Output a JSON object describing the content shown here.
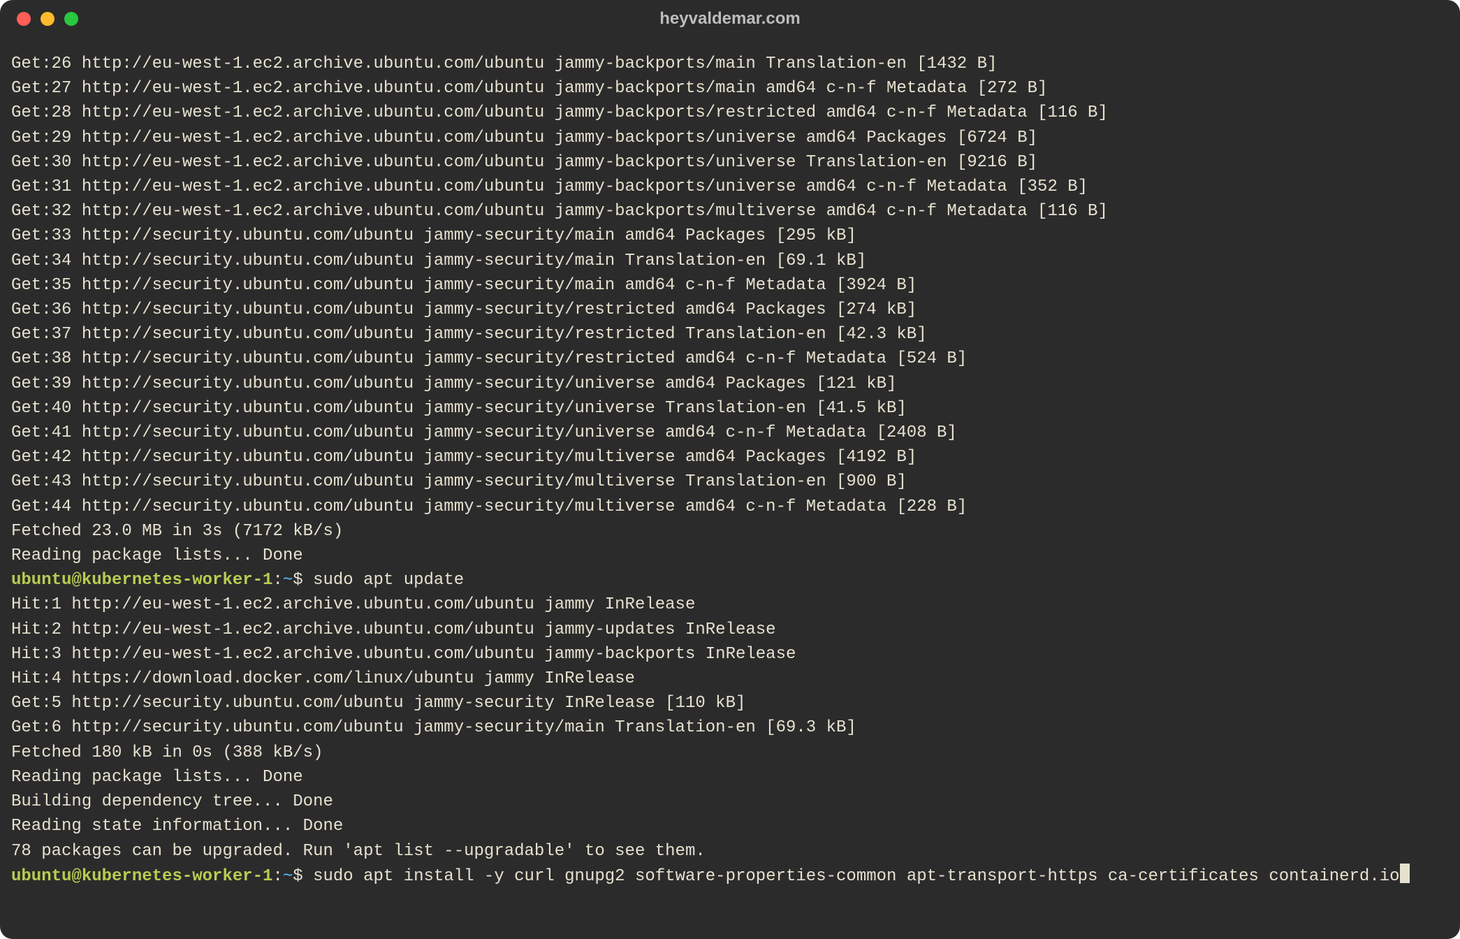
{
  "window": {
    "title": "heyvaldemar.com"
  },
  "prompt": {
    "user_host": "ubuntu@kubernetes-worker-1",
    "colon": ":",
    "path": "~",
    "dollar": "$"
  },
  "output": {
    "l0": "Get:26 http://eu-west-1.ec2.archive.ubuntu.com/ubuntu jammy-backports/main Translation-en [1432 B]",
    "l1": "Get:27 http://eu-west-1.ec2.archive.ubuntu.com/ubuntu jammy-backports/main amd64 c-n-f Metadata [272 B]",
    "l2": "Get:28 http://eu-west-1.ec2.archive.ubuntu.com/ubuntu jammy-backports/restricted amd64 c-n-f Metadata [116 B]",
    "l3": "Get:29 http://eu-west-1.ec2.archive.ubuntu.com/ubuntu jammy-backports/universe amd64 Packages [6724 B]",
    "l4": "Get:30 http://eu-west-1.ec2.archive.ubuntu.com/ubuntu jammy-backports/universe Translation-en [9216 B]",
    "l5": "Get:31 http://eu-west-1.ec2.archive.ubuntu.com/ubuntu jammy-backports/universe amd64 c-n-f Metadata [352 B]",
    "l6": "Get:32 http://eu-west-1.ec2.archive.ubuntu.com/ubuntu jammy-backports/multiverse amd64 c-n-f Metadata [116 B]",
    "l7": "Get:33 http://security.ubuntu.com/ubuntu jammy-security/main amd64 Packages [295 kB]",
    "l8": "Get:34 http://security.ubuntu.com/ubuntu jammy-security/main Translation-en [69.1 kB]",
    "l9": "Get:35 http://security.ubuntu.com/ubuntu jammy-security/main amd64 c-n-f Metadata [3924 B]",
    "l10": "Get:36 http://security.ubuntu.com/ubuntu jammy-security/restricted amd64 Packages [274 kB]",
    "l11": "Get:37 http://security.ubuntu.com/ubuntu jammy-security/restricted Translation-en [42.3 kB]",
    "l12": "Get:38 http://security.ubuntu.com/ubuntu jammy-security/restricted amd64 c-n-f Metadata [524 B]",
    "l13": "Get:39 http://security.ubuntu.com/ubuntu jammy-security/universe amd64 Packages [121 kB]",
    "l14": "Get:40 http://security.ubuntu.com/ubuntu jammy-security/universe Translation-en [41.5 kB]",
    "l15": "Get:41 http://security.ubuntu.com/ubuntu jammy-security/universe amd64 c-n-f Metadata [2408 B]",
    "l16": "Get:42 http://security.ubuntu.com/ubuntu jammy-security/multiverse amd64 Packages [4192 B]",
    "l17": "Get:43 http://security.ubuntu.com/ubuntu jammy-security/multiverse Translation-en [900 B]",
    "l18": "Get:44 http://security.ubuntu.com/ubuntu jammy-security/multiverse amd64 c-n-f Metadata [228 B]",
    "l19": "Fetched 23.0 MB in 3s (7172 kB/s)",
    "l20": "Reading package lists... Done",
    "l21": "Hit:1 http://eu-west-1.ec2.archive.ubuntu.com/ubuntu jammy InRelease",
    "l22": "Hit:2 http://eu-west-1.ec2.archive.ubuntu.com/ubuntu jammy-updates InRelease",
    "l23": "Hit:3 http://eu-west-1.ec2.archive.ubuntu.com/ubuntu jammy-backports InRelease",
    "l24": "Hit:4 https://download.docker.com/linux/ubuntu jammy InRelease",
    "l25": "Get:5 http://security.ubuntu.com/ubuntu jammy-security InRelease [110 kB]",
    "l26": "Get:6 http://security.ubuntu.com/ubuntu jammy-security/main Translation-en [69.3 kB]",
    "l27": "Fetched 180 kB in 0s (388 kB/s)",
    "l28": "Reading package lists... Done",
    "l29": "Building dependency tree... Done",
    "l30": "Reading state information... Done",
    "l31": "78 packages can be upgraded. Run 'apt list --upgradable' to see them."
  },
  "commands": {
    "c1": " sudo apt update",
    "c2": " sudo apt install -y curl gnupg2 software-properties-common apt-transport-https ca-certificates containerd.io"
  }
}
